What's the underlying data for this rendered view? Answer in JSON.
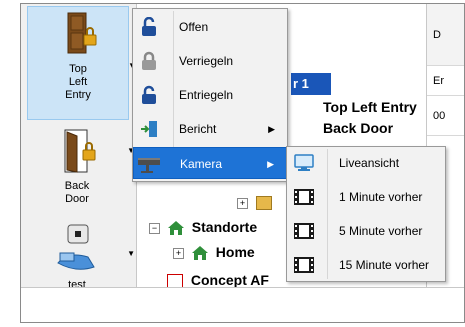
{
  "devices": [
    {
      "label_lines": [
        "Top",
        "Left",
        "Entry"
      ],
      "icon": "door-locked-icon"
    },
    {
      "label_lines": [
        "Back",
        "Door"
      ],
      "icon": "door-open-locked-icon"
    },
    {
      "label_lines": [
        "test"
      ],
      "icon": "camera-device-icon"
    }
  ],
  "tree": {
    "header_fragment": "r 1",
    "row1": "Top Left Entry",
    "row2": "Back Door",
    "standorte": "Standorte",
    "home": "Home",
    "partial": "Concept AF"
  },
  "grid": {
    "header": "D",
    "row1": "Er",
    "row2": "00"
  },
  "context_menu": {
    "items": [
      {
        "label": "Offen",
        "icon": "padlock-open-icon"
      },
      {
        "label": "Verriegeln",
        "icon": "padlock-grey-icon"
      },
      {
        "label": "Entriegeln",
        "icon": "padlock-unlock-icon"
      },
      {
        "label": "Bericht",
        "icon": "report-door-icon",
        "submenu": true
      },
      {
        "label": "Kamera",
        "icon": "camera-icon",
        "submenu": true,
        "highlighted": true
      }
    ]
  },
  "camera_submenu": {
    "items": [
      {
        "label": "Liveansicht",
        "icon": "monitor-icon"
      },
      {
        "label": "1 Minute vorher",
        "icon": "film-icon"
      },
      {
        "label": "5 Minute vorher",
        "icon": "film-icon"
      },
      {
        "label": "15 Minute vorher",
        "icon": "film-icon"
      }
    ]
  },
  "colors": {
    "highlight": "#1e73d6",
    "header_blue": "#1a56b8",
    "house_green": "#2f8f3a",
    "door_brown": "#7a4a1a",
    "lock_gold": "#e3a51a"
  }
}
